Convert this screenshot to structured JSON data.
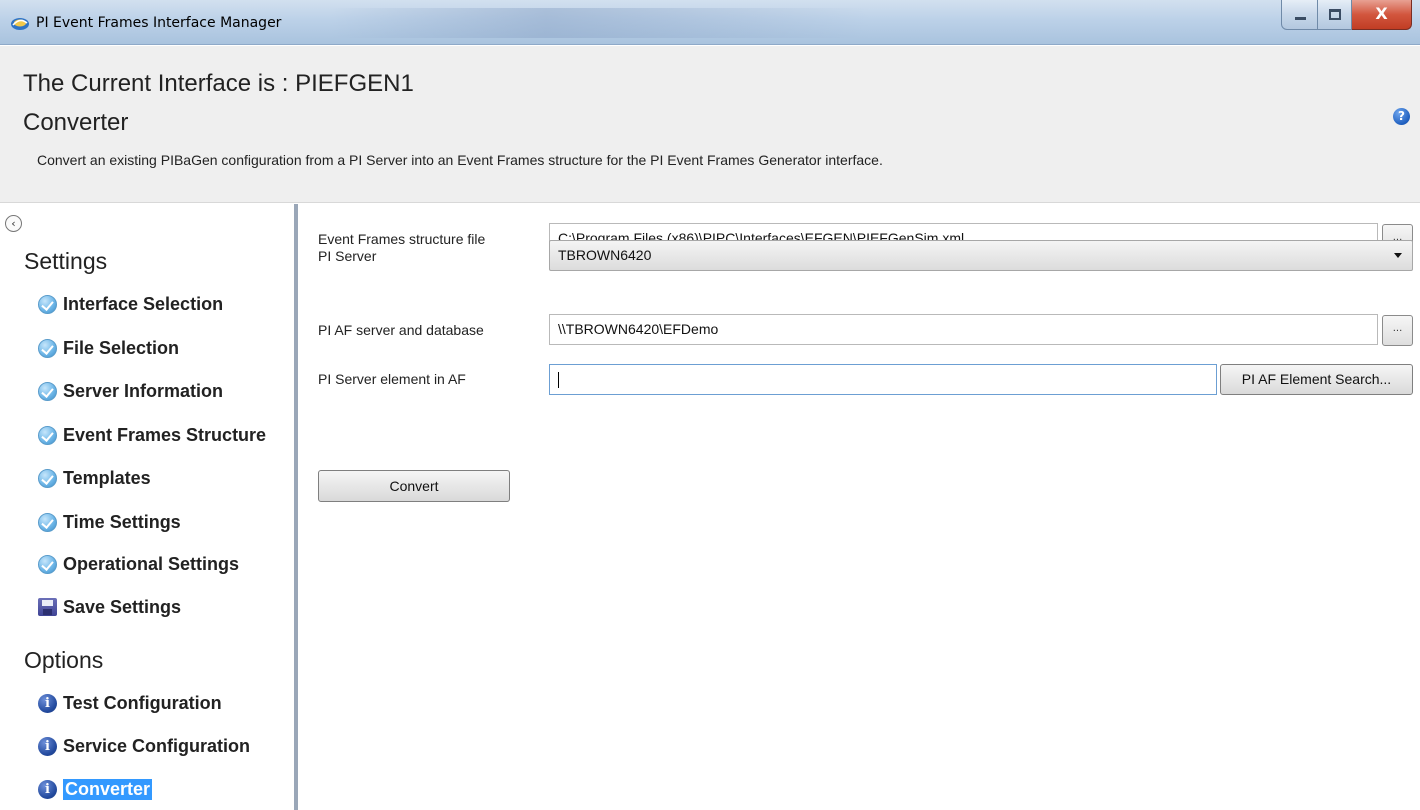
{
  "window": {
    "title": "PI Event Frames Interface Manager",
    "app_icon": "pi-app-icon",
    "controls": {
      "minimize": "minimize-icon",
      "maximize": "maximize-icon",
      "close_glyph": "X"
    }
  },
  "header": {
    "title": "The Current Interface is : PIEFGEN1",
    "subtitle": "Converter",
    "description": "Convert an existing PIBaGen configuration from a PI Server into an Event Frames structure for the PI Event Frames Generator interface.",
    "help_glyph": "?"
  },
  "sidebar": {
    "collapse_glyph": "‹",
    "settings_title": "Settings",
    "settings_items": [
      {
        "label": "Interface Selection",
        "icon": "check-circle-icon"
      },
      {
        "label": "File Selection",
        "icon": "check-circle-icon"
      },
      {
        "label": "Server Information",
        "icon": "check-circle-icon"
      },
      {
        "label": "Event Frames Structure",
        "icon": "check-circle-icon"
      },
      {
        "label": "Templates",
        "icon": "check-circle-icon"
      },
      {
        "label": "Time Settings",
        "icon": "check-circle-icon"
      },
      {
        "label": "Operational Settings",
        "icon": "check-circle-icon"
      },
      {
        "label": "Save Settings",
        "icon": "floppy-disk-icon"
      }
    ],
    "options_title": "Options",
    "options_items": [
      {
        "label": "Test Configuration",
        "icon": "info-icon"
      },
      {
        "label": "Service Configuration",
        "icon": "info-icon"
      },
      {
        "label": "Converter",
        "icon": "info-icon",
        "selected": true
      }
    ],
    "info_glyph": "i"
  },
  "form": {
    "structure_file": {
      "label": "Event Frames structure file",
      "value": "C:\\Program Files (x86)\\PIPC\\Interfaces\\EFGEN\\PIEFGenSim.xml"
    },
    "pi_server": {
      "label": "PI Server",
      "value": "TBROWN6420"
    },
    "af_database": {
      "label": "PI AF server and database",
      "value": "\\\\TBROWN6420\\EFDemo"
    },
    "server_element": {
      "label": "PI Server element in AF",
      "value": ""
    },
    "browse_label": "...",
    "search_button_label": "PI AF Element Search...",
    "convert_button_label": "Convert"
  },
  "colors": {
    "selection_highlight": "#3399ff",
    "sidebar_divider": "#9aa7b8",
    "header_bg": "#efefef"
  }
}
